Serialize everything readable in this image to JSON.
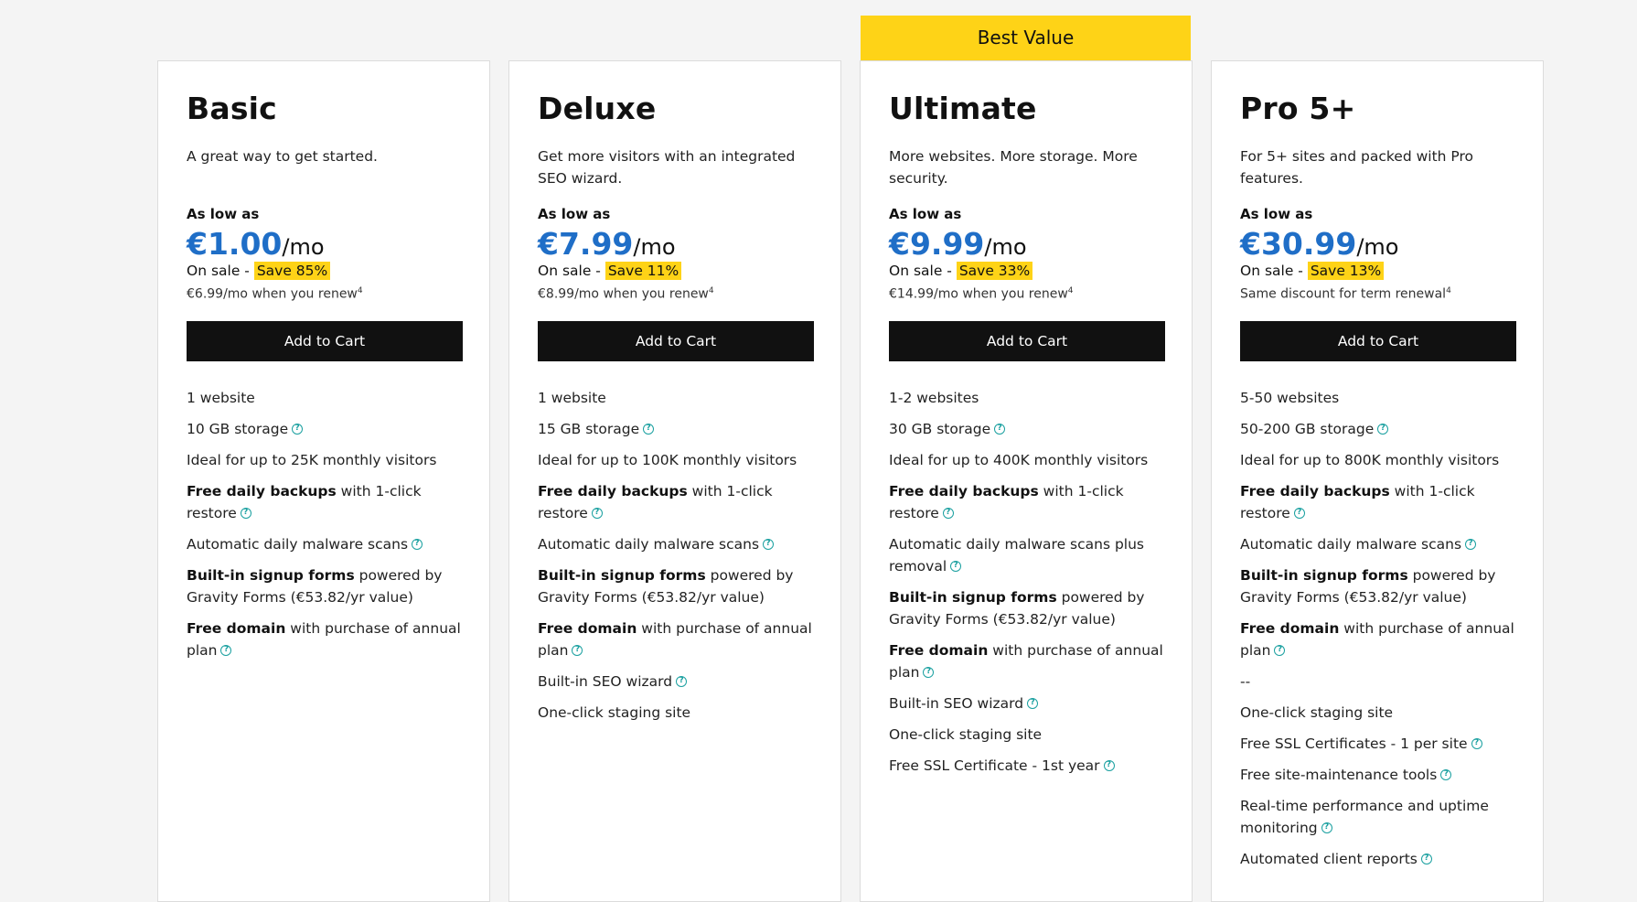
{
  "best_banner": "Best Value",
  "plans": [
    {
      "name": "Basic",
      "desc": "A great way to get started.",
      "as_low": "As low as",
      "price": "€1.00",
      "per": "/mo",
      "sale_prefix": "On sale - ",
      "save": "Save 85%",
      "renew": "€6.99/mo when you renew",
      "renew_sup": "4",
      "cart": "Add to Cart",
      "features": [
        {
          "bold": "",
          "text": "1 website",
          "help": false
        },
        {
          "bold": "",
          "text": "10 GB storage",
          "help": true
        },
        {
          "bold": "",
          "text": "Ideal for up to 25K monthly visitors",
          "help": false
        },
        {
          "bold": "Free daily backups",
          "text": " with 1-click restore",
          "help": true
        },
        {
          "bold": "",
          "text": "Automatic daily malware scans",
          "help": true
        },
        {
          "bold": "Built-in signup forms",
          "text": " powered by Gravity Forms (€53.82/yr value)",
          "help": false
        },
        {
          "bold": "Free domain",
          "text": " with purchase of annual plan",
          "help": true
        }
      ]
    },
    {
      "name": "Deluxe",
      "desc": "Get more visitors with an integrated SEO wizard.",
      "as_low": "As low as",
      "price": "€7.99",
      "per": "/mo",
      "sale_prefix": "On sale - ",
      "save": "Save 11%",
      "renew": "€8.99/mo when you renew",
      "renew_sup": "4",
      "cart": "Add to Cart",
      "features": [
        {
          "bold": "",
          "text": "1 website",
          "help": false
        },
        {
          "bold": "",
          "text": "15 GB storage",
          "help": true
        },
        {
          "bold": "",
          "text": "Ideal for up to 100K monthly visitors",
          "help": false
        },
        {
          "bold": "Free daily backups",
          "text": " with 1-click restore",
          "help": true
        },
        {
          "bold": "",
          "text": "Automatic daily malware scans",
          "help": true
        },
        {
          "bold": "Built-in signup forms",
          "text": " powered by Gravity Forms (€53.82/yr value)",
          "help": false
        },
        {
          "bold": "Free domain",
          "text": " with purchase of annual plan",
          "help": true
        },
        {
          "bold": "",
          "text": "Built-in SEO wizard",
          "help": true
        },
        {
          "bold": "",
          "text": "One-click staging site",
          "help": false
        }
      ]
    },
    {
      "name": "Ultimate",
      "desc": "More websites. More storage. More security.",
      "as_low": "As low as",
      "price": "€9.99",
      "per": "/mo",
      "sale_prefix": "On sale - ",
      "save": "Save 33%",
      "renew": "€14.99/mo when you renew",
      "renew_sup": "4",
      "cart": "Add to Cart",
      "features": [
        {
          "bold": "",
          "text": "1-2 websites",
          "help": false
        },
        {
          "bold": "",
          "text": "30 GB storage",
          "help": true
        },
        {
          "bold": "",
          "text": "Ideal for up to 400K monthly visitors",
          "help": false
        },
        {
          "bold": "Free daily backups",
          "text": " with 1-click restore",
          "help": true
        },
        {
          "bold": "",
          "text": "Automatic daily malware scans plus removal",
          "help": true
        },
        {
          "bold": "Built-in signup forms",
          "text": " powered by Gravity Forms (€53.82/yr value)",
          "help": false
        },
        {
          "bold": "Free domain",
          "text": " with purchase of annual plan",
          "help": true
        },
        {
          "bold": "",
          "text": "Built-in SEO wizard",
          "help": true
        },
        {
          "bold": "",
          "text": "One-click staging site",
          "help": false
        },
        {
          "bold": "",
          "text": "Free SSL Certificate - 1st year",
          "help": true
        }
      ]
    },
    {
      "name": "Pro 5+",
      "desc": "For 5+ sites and packed with Pro features.",
      "as_low": "As low as",
      "price": "€30.99",
      "per": "/mo",
      "sale_prefix": "On sale - ",
      "save": "Save 13%",
      "renew": "Same discount for term renewal",
      "renew_sup": "4",
      "cart": "Add to Cart",
      "features": [
        {
          "bold": "",
          "text": "5-50 websites",
          "help": false
        },
        {
          "bold": "",
          "text": "50-200 GB storage",
          "help": true
        },
        {
          "bold": "",
          "text": "Ideal for up to 800K monthly visitors",
          "help": false
        },
        {
          "bold": "Free daily backups",
          "text": " with 1-click restore",
          "help": true
        },
        {
          "bold": "",
          "text": "Automatic daily malware scans",
          "help": true
        },
        {
          "bold": "Built-in signup forms",
          "text": " powered by Gravity Forms (€53.82/yr value)",
          "help": false
        },
        {
          "bold": "Free domain",
          "text": " with purchase of annual plan",
          "help": true
        },
        {
          "bold": "",
          "text": "--",
          "help": false
        },
        {
          "bold": "",
          "text": "One-click staging site",
          "help": false
        },
        {
          "bold": "",
          "text": "Free SSL Certificates - 1 per site",
          "help": true
        },
        {
          "bold": "",
          "text": "Free site-maintenance tools",
          "help": true
        },
        {
          "bold": "",
          "text": "Real-time performance and uptime monitoring",
          "help": true
        },
        {
          "bold": "",
          "text": "Automated client reports",
          "help": true
        }
      ]
    }
  ]
}
